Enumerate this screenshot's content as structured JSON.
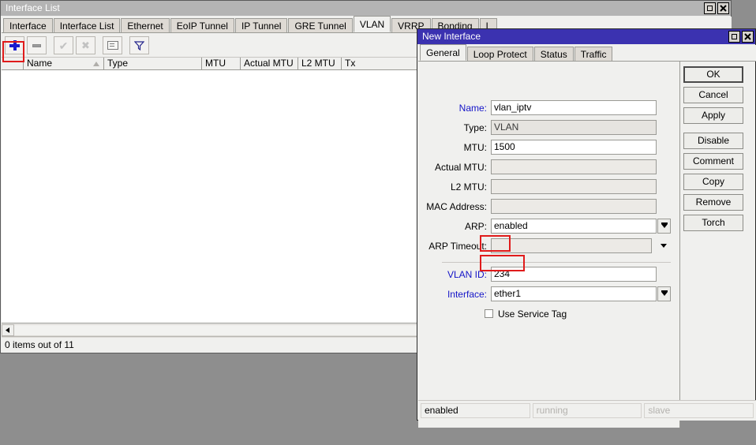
{
  "main_window": {
    "title": "Interface List",
    "titlebar_buttons": [
      {
        "name": "maximize",
        "glyph": "□"
      },
      {
        "name": "close",
        "glyph": "✕"
      }
    ],
    "tabs": [
      "Interface",
      "Interface List",
      "Ethernet",
      "EoIP Tunnel",
      "IP Tunnel",
      "GRE Tunnel",
      "VLAN",
      "VRRP",
      "Bonding",
      "L"
    ],
    "active_tab": "VLAN",
    "toolbar": [
      {
        "name": "add-button",
        "icon": "plus-icon",
        "enabled": true,
        "highlighted": true
      },
      {
        "name": "remove-button",
        "icon": "minus-icon",
        "enabled": false
      },
      {
        "name": "enable-button",
        "icon": "check-icon",
        "enabled": false
      },
      {
        "name": "disable-button",
        "icon": "cross-icon",
        "enabled": false
      },
      {
        "name": "comment-button",
        "icon": "comment-icon",
        "enabled": true
      },
      {
        "name": "filter-button",
        "icon": "funnel-icon",
        "enabled": true
      }
    ],
    "columns": [
      "Name",
      "Type",
      "MTU",
      "Actual MTU",
      "L2 MTU",
      "Tx"
    ],
    "sort_column": "Name",
    "sort_direction": "ascending",
    "rows": [],
    "status_text": "0 items out of 11"
  },
  "dialog": {
    "title": "New Interface",
    "titlebar_buttons": [
      {
        "name": "maximize",
        "glyph": "□"
      },
      {
        "name": "close",
        "glyph": "✕"
      }
    ],
    "tabs": [
      "General",
      "Loop Protect",
      "Status",
      "Traffic"
    ],
    "active_tab": "General",
    "fields": [
      {
        "label": "Name:",
        "value": "vlan_iptv",
        "readonly": false,
        "highlight_label": true,
        "dropdown": "none"
      },
      {
        "label": "Type:",
        "value": "VLAN",
        "readonly": true,
        "highlight_label": false,
        "dropdown": "none"
      },
      {
        "label": "MTU:",
        "value": "1500",
        "readonly": false,
        "highlight_label": false,
        "dropdown": "none"
      },
      {
        "label": "Actual MTU:",
        "value": "",
        "readonly": true,
        "highlight_label": false,
        "dropdown": "none"
      },
      {
        "label": "L2 MTU:",
        "value": "",
        "readonly": true,
        "highlight_label": false,
        "dropdown": "none"
      },
      {
        "label": "MAC Address:",
        "value": "",
        "readonly": true,
        "highlight_label": false,
        "dropdown": "none"
      },
      {
        "label": "ARP:",
        "value": "enabled",
        "readonly": false,
        "highlight_label": false,
        "dropdown": "boxed"
      },
      {
        "label": "ARP Timeout:",
        "value": "",
        "readonly": true,
        "highlight_label": false,
        "dropdown": "flat"
      },
      {
        "label": "VLAN ID:",
        "value": "234",
        "readonly": false,
        "highlight_label": true,
        "dropdown": "none",
        "annotated": true
      },
      {
        "label": "Interface:",
        "value": "ether1",
        "readonly": false,
        "highlight_label": true,
        "dropdown": "boxed",
        "annotated": true
      }
    ],
    "checkbox": {
      "label": "Use Service Tag",
      "checked": false
    },
    "buttons": [
      "OK",
      "Cancel",
      "Apply",
      "Disable",
      "Comment",
      "Copy",
      "Remove",
      "Torch"
    ],
    "default_button": "OK",
    "status_cells": [
      {
        "text": "enabled",
        "active": true
      },
      {
        "text": "running",
        "active": false
      },
      {
        "text": "slave",
        "active": false
      }
    ]
  },
  "annotations": {
    "color": "#e01b1b",
    "boxes": [
      "add-button",
      "vlan-id-value",
      "interface-value"
    ]
  }
}
